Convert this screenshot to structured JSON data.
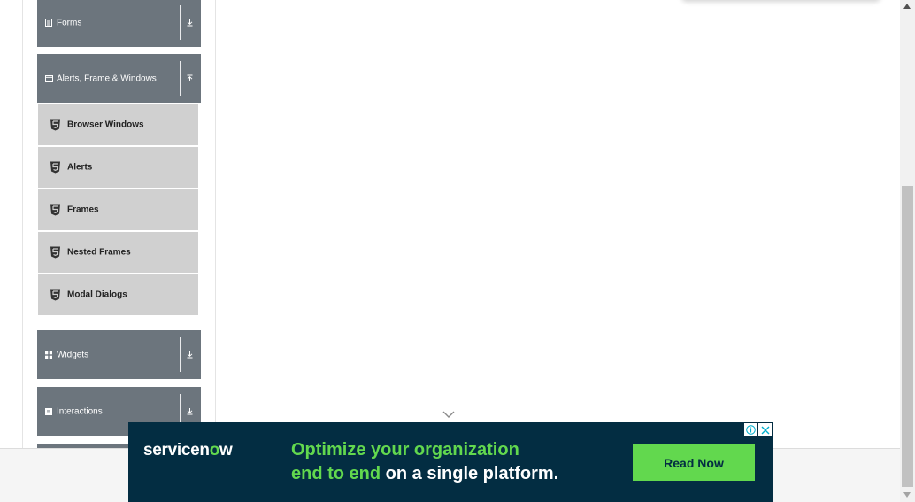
{
  "sidebar": {
    "groups": [
      {
        "label": "Forms",
        "icon": "form-icon",
        "state": "collapsed"
      },
      {
        "label": "Alerts, Frame & Windows",
        "icon": "window-icon",
        "state": "expanded"
      },
      {
        "label": "Widgets",
        "icon": "grid-icon",
        "state": "collapsed"
      },
      {
        "label": "Interactions",
        "icon": "interactions-icon",
        "state": "collapsed"
      }
    ],
    "items": [
      {
        "label": "Browser Windows",
        "icon": "html5-icon"
      },
      {
        "label": "Alerts",
        "icon": "html5-icon"
      },
      {
        "label": "Frames",
        "icon": "html5-icon"
      },
      {
        "label": "Nested Frames",
        "icon": "html5-icon"
      },
      {
        "label": "Modal Dialogs",
        "icon": "html5-icon"
      }
    ]
  },
  "ad": {
    "brand": "servicen",
    "brand_mark": "o",
    "brand_end": "w",
    "headline_line1_green": "Optimize your organization",
    "headline_line2_green": "end to end",
    "headline_line2_white": " on a single platform.",
    "cta": "Read Now",
    "info_icon": "info-icon",
    "close_icon": "close-icon"
  },
  "colors": {
    "group_bg": "#6c757d",
    "item_bg": "#d0d0d0",
    "ad_bg": "#032d42",
    "ad_accent": "#62d84e"
  }
}
